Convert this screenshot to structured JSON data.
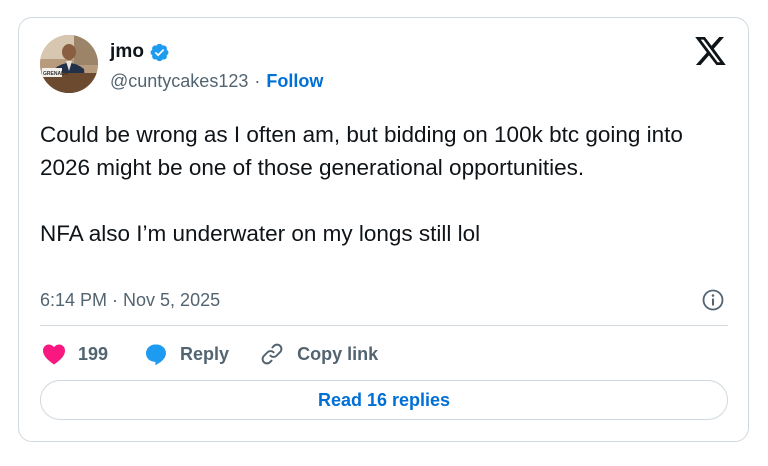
{
  "author": {
    "name": "jmo",
    "handle": "@cuntycakes123",
    "follow_label": "Follow",
    "separator": "·",
    "verified": true,
    "avatar_sign_text": "GRENADA"
  },
  "tweet": {
    "paragraphs": [
      "Could be wrong as I often am, but bidding on 100k btc going into 2026 might be one of those generational opportunities.",
      "NFA also I’m underwater on my longs still lol"
    ],
    "timestamp": "6:14 PM · Nov 5, 2025"
  },
  "actions": {
    "like_count": "199",
    "reply_label": "Reply",
    "copy_link_label": "Copy link"
  },
  "read_replies_label": "Read 16 replies",
  "colors": {
    "like": "#f91880",
    "reply": "#1d9bf0",
    "link": "#006fd6",
    "verified": "#1d9bf0",
    "muted": "#536471"
  },
  "icons": [
    "verified-badge-icon",
    "x-logo-icon",
    "info-icon",
    "heart-icon",
    "reply-bubble-icon",
    "link-icon"
  ]
}
